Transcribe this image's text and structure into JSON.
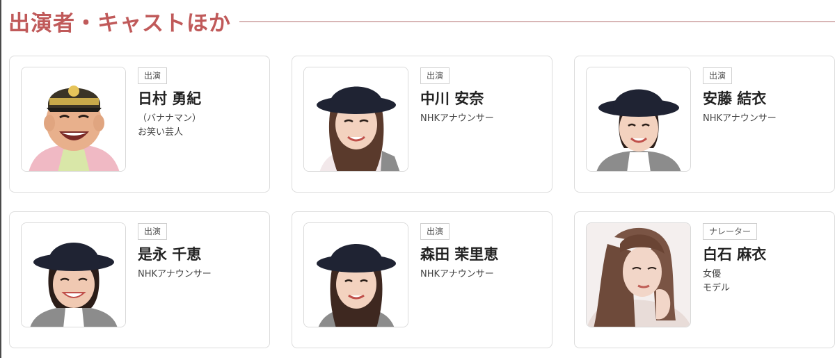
{
  "section": {
    "title": "出演者・キャストほか"
  },
  "cast": [
    {
      "role": "出演",
      "name": "日村 勇紀",
      "detail": "（バナナマン）\nお笑い芸人",
      "photo_icon": "portrait-comedian-cap"
    },
    {
      "role": "出演",
      "name": "中川 安奈",
      "detail": "NHKアナウンサー",
      "photo_icon": "portrait-woman-hat"
    },
    {
      "role": "出演",
      "name": "安藤 結衣",
      "detail": "NHKアナウンサー",
      "photo_icon": "portrait-woman-hat"
    },
    {
      "role": "出演",
      "name": "是永 千恵",
      "detail": "NHKアナウンサー",
      "photo_icon": "portrait-woman-hat"
    },
    {
      "role": "出演",
      "name": "森田 茉里恵",
      "detail": "NHKアナウンサー",
      "photo_icon": "portrait-woman-hat"
    },
    {
      "role": "ナレーター",
      "name": "白石 麻衣",
      "detail": "女優\nモデル",
      "photo_icon": "portrait-woman-hair"
    }
  ],
  "colors": {
    "heading": "#c05a5a",
    "rule": "#d8b6b6",
    "hat": "#1f2333",
    "skin": "#f3d2bf",
    "hair": "#4a3024",
    "vest": "#8c8c8c"
  }
}
